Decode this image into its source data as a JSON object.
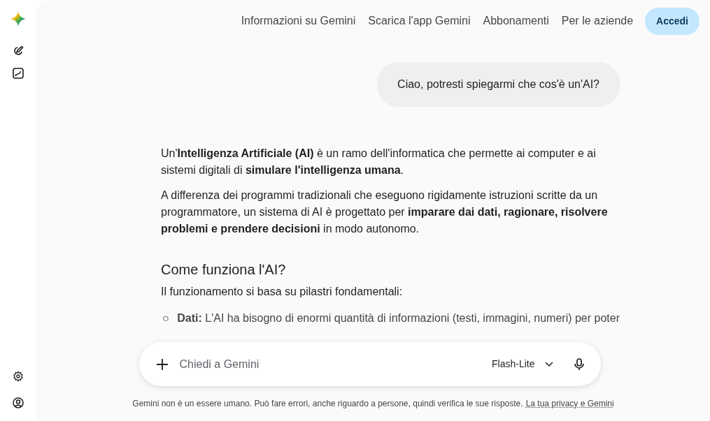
{
  "header": {
    "nav_links": [
      "Informazioni su Gemini",
      "Scarica l'app Gemini",
      "Abbonamenti",
      "Per le aziende"
    ],
    "sign_in_button": "Accedi"
  },
  "conversation": {
    "user_message": "Ciao, potresti spiegarmi che cos'è un'AI?",
    "response": [
      {
        "kind": "paragraph",
        "text": "Un'**Intelligenza Artificiale (AI)** è un ramo dell'informatica che permette ai computer e ai sistemi digitali di **simulare l'intelligenza umana**."
      },
      {
        "kind": "paragraph",
        "text": "A differenza dei programmi tradizionali che eseguono rigidamente istruzioni scritte da un programmatore, un sistema di AI è progettato per **imparare dai dati, ragionare, risolvere problemi e prendere decisioni** in modo autonomo."
      },
      {
        "kind": "heading",
        "text": "Come funziona l'AI?"
      },
      {
        "kind": "paragraph",
        "text": "Il funzionamento si basa su pilastri fondamentali:"
      },
      {
        "kind": "bullet",
        "marker": "○",
        "text": "**Dati:** L'AI ha bisogno di enormi quantità di informazioni (testi, immagini, numeri) per poter"
      }
    ]
  },
  "composer": {
    "placeholder": "Chiedi a Gemini",
    "model": "Flash-Lite"
  },
  "footer": {
    "disclaimer": "Gemini non è un essere umano. Può fare errori, anche riguardo a persone, quindi verifica le sue risposte.",
    "privacy_link": "La tua privacy e Gemini"
  }
}
